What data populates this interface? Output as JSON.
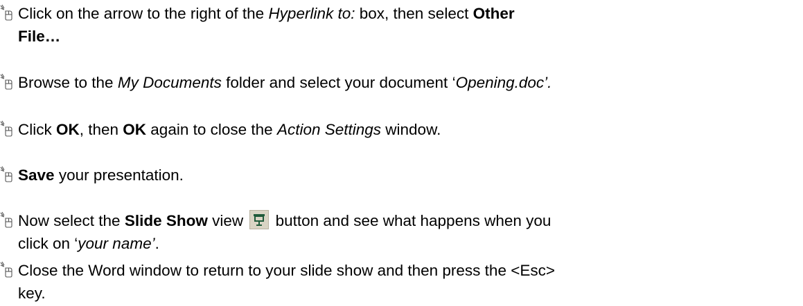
{
  "steps": [
    {
      "line1": {
        "a": "Click on the arrow to the right of the ",
        "b": "Hyperlink to:",
        "c": " box, then select ",
        "d": "Other"
      },
      "line2": {
        "a": "File…"
      }
    },
    {
      "line1": {
        "a": "Browse to the ",
        "b": "My Documents",
        "c": " folder and select your document ‘",
        "d": "Opening.doc’."
      }
    },
    {
      "line1": {
        "a": "Click ",
        "b": "OK",
        "c": ", then ",
        "d": "OK",
        "e": " again to close the ",
        "f": "Action Settings",
        "g": " window."
      }
    },
    {
      "line1": {
        "a": "Save",
        "b": " your presentation."
      }
    },
    {
      "line1": {
        "a": "Now select the ",
        "b": "Slide Show",
        "c": " view ",
        "d": " button and see what happens when you"
      },
      "line2": {
        "a": "click on ‘",
        "b": "your name’",
        "c": "."
      }
    },
    {
      "line1": {
        "a": "Close the Word window to return to your slide show and then press the <Esc>"
      },
      "line2": {
        "a": "key."
      }
    }
  ],
  "icons": {
    "bullet": "mouse-click-icon",
    "slide_show_button": "slide-show-view-icon"
  },
  "colors": {
    "text": "#000000",
    "icon_stroke": "#555555",
    "button_bg": "#d9d4c4",
    "button_icon": "#1f5a3a"
  }
}
